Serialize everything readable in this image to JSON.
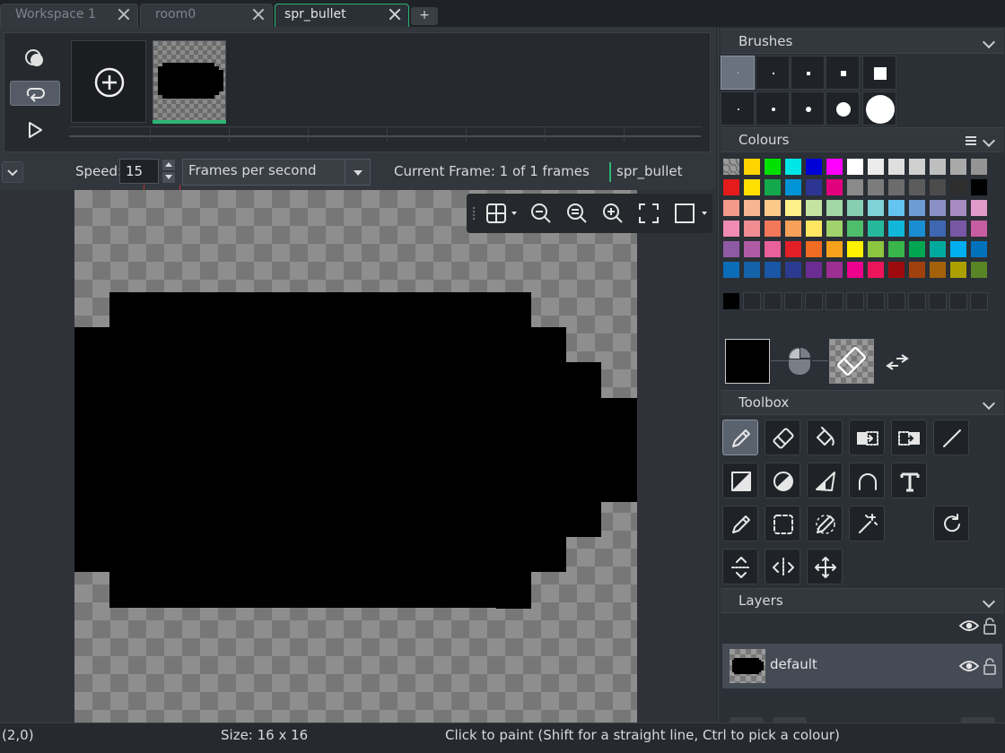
{
  "tabs": [
    {
      "label": "Workspace 1",
      "active": false
    },
    {
      "label": "room0",
      "active": false
    },
    {
      "label": "spr_bullet",
      "active": true
    }
  ],
  "new_tab_label": "+",
  "frame_panel": {
    "add_frame_tooltip": "",
    "frames": [
      {
        "index": 1,
        "selected": true
      }
    ]
  },
  "speed_bar": {
    "speed_label": "Speed:",
    "speed_value": "15",
    "unit_value": "Frames per second",
    "current_frame": "Current Frame: 1 of 1 frames",
    "sprite_name": "spr_bullet"
  },
  "status_bar": {
    "cursor": "(2,0)",
    "size": "Size: 16 x 16",
    "hint": "Click to paint (Shift for a straight line, Ctrl to pick a colour)"
  },
  "panels": {
    "brushes": "Brushes",
    "colours": "Colours",
    "toolbox": "Toolbox",
    "layers": "Layers"
  },
  "palette_rows": [
    [
      "checker",
      "#ffd400",
      "#00e000",
      "#00e5e5",
      "#0000d8",
      "#ff00ff",
      "#ffffff",
      "#ececec",
      "#dedede",
      "#cfcfcf",
      "#bebebe",
      "#a9a9a9",
      "#949494"
    ],
    [
      "#e31b1b",
      "#ffe000",
      "#14a84c",
      "#0093d6",
      "#2d3592",
      "#e1007e",
      "#8a8a8a",
      "#7c7c7c",
      "#6c6c6c",
      "#5c5c5c",
      "#4c4c4c",
      "#2e2e2e",
      "#000000"
    ],
    [
      "#f39a8b",
      "#f6b691",
      "#fcc98a",
      "#fef08a",
      "#c6e2a0",
      "#a2d7a6",
      "#86cfb1",
      "#7fd2d7",
      "#63c4ef",
      "#6e9bd4",
      "#8a90c6",
      "#a78cc2",
      "#e09bcb"
    ],
    [
      "#f08bb5",
      "#f28c93",
      "#f3775b",
      "#f6a15a",
      "#fde760",
      "#9fd26a",
      "#4ebd6c",
      "#25b99c",
      "#11b7d9",
      "#1a8ed2",
      "#3f67b1",
      "#7857a4",
      "#c65ca2"
    ],
    [
      "#8f5aa4",
      "#b05ca5",
      "#e9619b",
      "#e31e26",
      "#ef6c22",
      "#f6a11b",
      "#fff200",
      "#8dc63f",
      "#39b54a",
      "#00a651",
      "#00a99d",
      "#00aeef",
      "#0072bc"
    ],
    [
      "#0b6db7",
      "#1462a8",
      "#1956a5",
      "#2c3b8f",
      "#6a2d91",
      "#9d2e92",
      "#ec008c",
      "#ed145b",
      "#9e0b0f",
      "#a0410d",
      "#a3620a",
      "#aba000",
      "#598527"
    ]
  ],
  "recent_colours": [
    "#000000",
    "",
    "",
    "",
    "",
    "",
    "",
    "",
    "",
    "",
    "",
    "",
    ""
  ],
  "layers": [
    {
      "name": "default",
      "visible": true,
      "locked": false
    }
  ],
  "colors": {
    "accent": "#2bb673",
    "active_colour": "#000000"
  }
}
